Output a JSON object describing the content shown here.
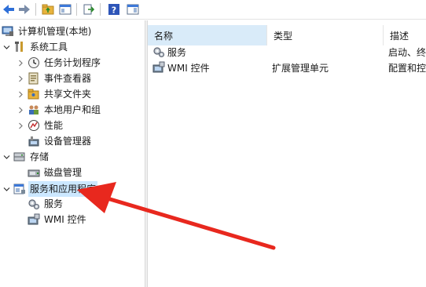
{
  "toolbar": {
    "buttons": [
      {
        "icon": "back-arrow-icon"
      },
      {
        "icon": "forward-arrow-icon"
      },
      {
        "icon": "up-folder-icon"
      },
      {
        "icon": "show-hide-console-tree-icon"
      },
      {
        "icon": "export-list-icon"
      },
      {
        "icon": "help-icon",
        "glyph": "?"
      },
      {
        "icon": "show-action-pane-icon"
      }
    ]
  },
  "tree": {
    "root": {
      "label": "计算机管理(本地)"
    },
    "system_tools": {
      "label": "系统工具"
    },
    "task_scheduler": {
      "label": "任务计划程序"
    },
    "event_viewer": {
      "label": "事件查看器"
    },
    "shared_folders": {
      "label": "共享文件夹"
    },
    "local_users": {
      "label": "本地用户和组"
    },
    "performance": {
      "label": "性能"
    },
    "device_manager": {
      "label": "设备管理器"
    },
    "storage": {
      "label": "存储"
    },
    "disk_management": {
      "label": "磁盘管理"
    },
    "services_apps": {
      "label": "服务和应用程序"
    },
    "services": {
      "label": "服务"
    },
    "wmi": {
      "label": "WMI 控件"
    }
  },
  "list": {
    "columns": [
      "名称",
      "类型",
      "描述"
    ],
    "rows": [
      {
        "name": "服务",
        "type": "",
        "desc": "启动、终"
      },
      {
        "name": "WMI 控件",
        "type": "扩展管理单元",
        "desc": "配置和控"
      }
    ]
  },
  "colors": {
    "arrow": "#e8281e",
    "selected_bg": "#cce8ff",
    "header_active_bg": "#d9ebf9",
    "toolbar_blue": "#2e6fd8",
    "folder_yellow": "#e8b33c"
  }
}
